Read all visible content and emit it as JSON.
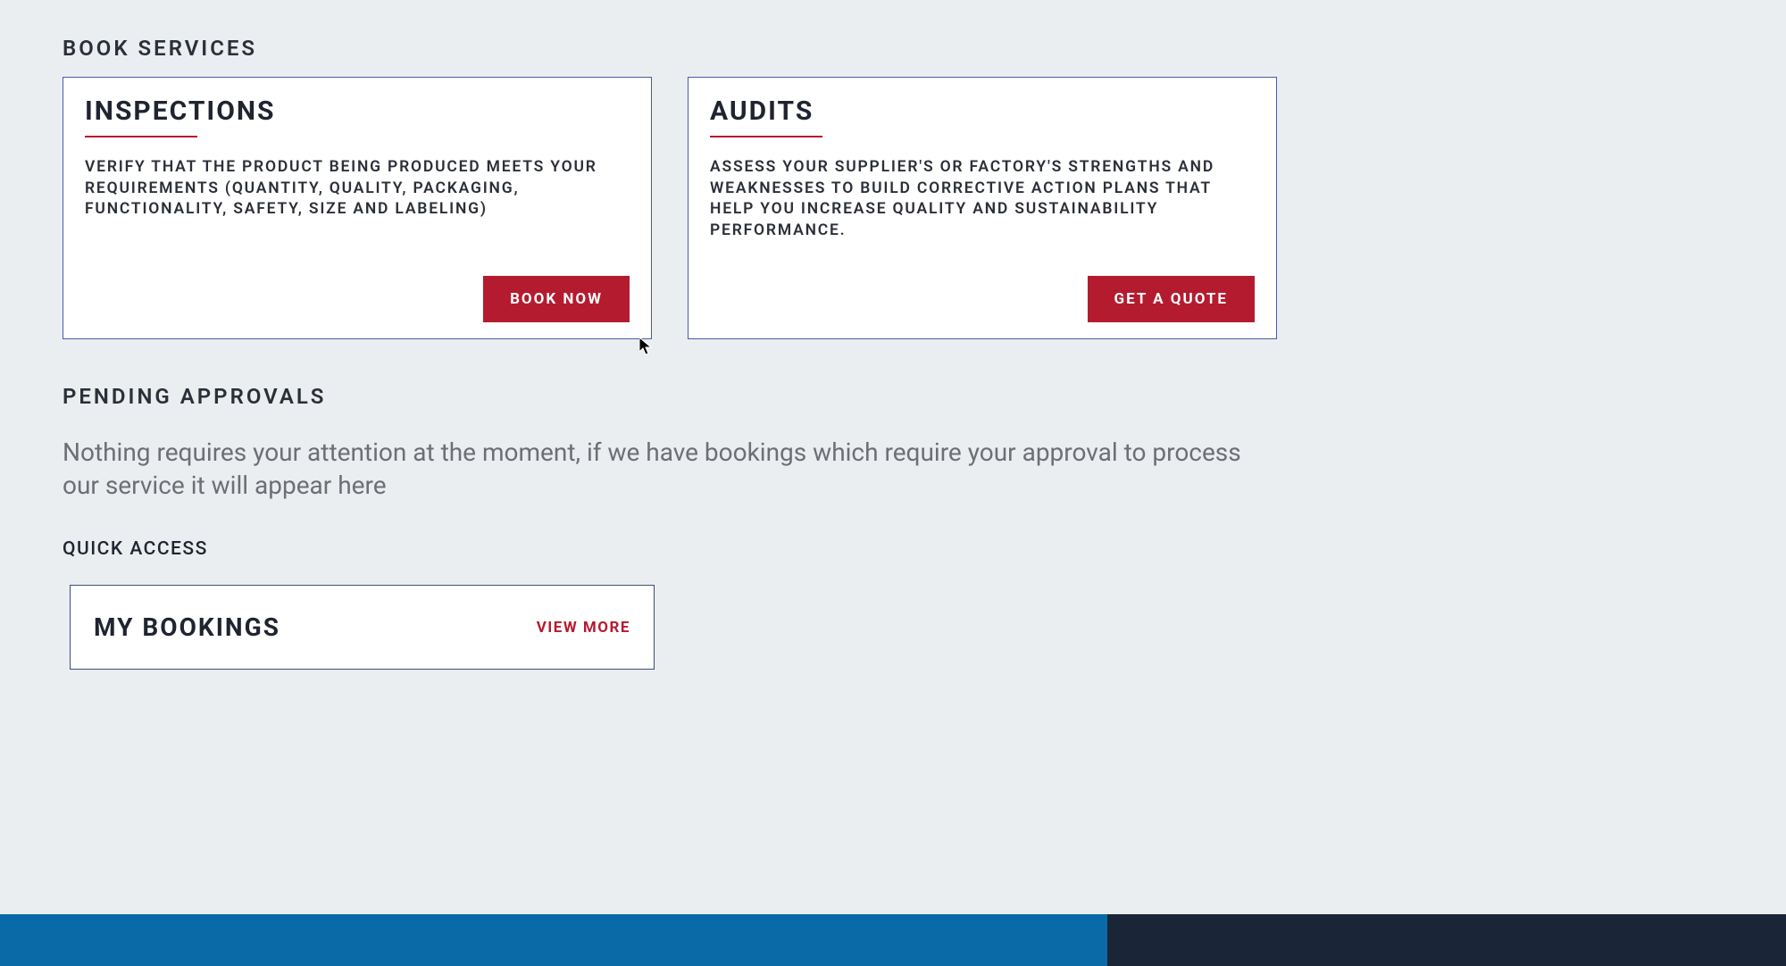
{
  "sections": {
    "book_services": {
      "heading": "BOOK SERVICES",
      "cards": [
        {
          "title": "INSPECTIONS",
          "description": "VERIFY THAT THE PRODUCT BEING PRODUCED MEETS YOUR REQUIREMENTS (QUANTITY, QUALITY, PACKAGING, FUNCTIONALITY, SAFETY, SIZE AND LABELING)",
          "button_label": "BOOK NOW"
        },
        {
          "title": "AUDITS",
          "description": "ASSESS YOUR SUPPLIER'S OR FACTORY'S STRENGTHS AND WEAKNESSES TO BUILD CORRECTIVE ACTION PLANS THAT HELP YOU INCREASE QUALITY AND SUSTAINABILITY PERFORMANCE.",
          "button_label": "GET A QUOTE"
        }
      ]
    },
    "pending_approvals": {
      "heading": "PENDING APPROVALS",
      "message": "Nothing requires your attention at the moment, if we have bookings which require your approval to process our service it will appear here"
    },
    "quick_access": {
      "heading": "QUICK ACCESS",
      "bookings": {
        "title": "MY BOOKINGS",
        "link_label": "VIEW MORE"
      }
    }
  }
}
